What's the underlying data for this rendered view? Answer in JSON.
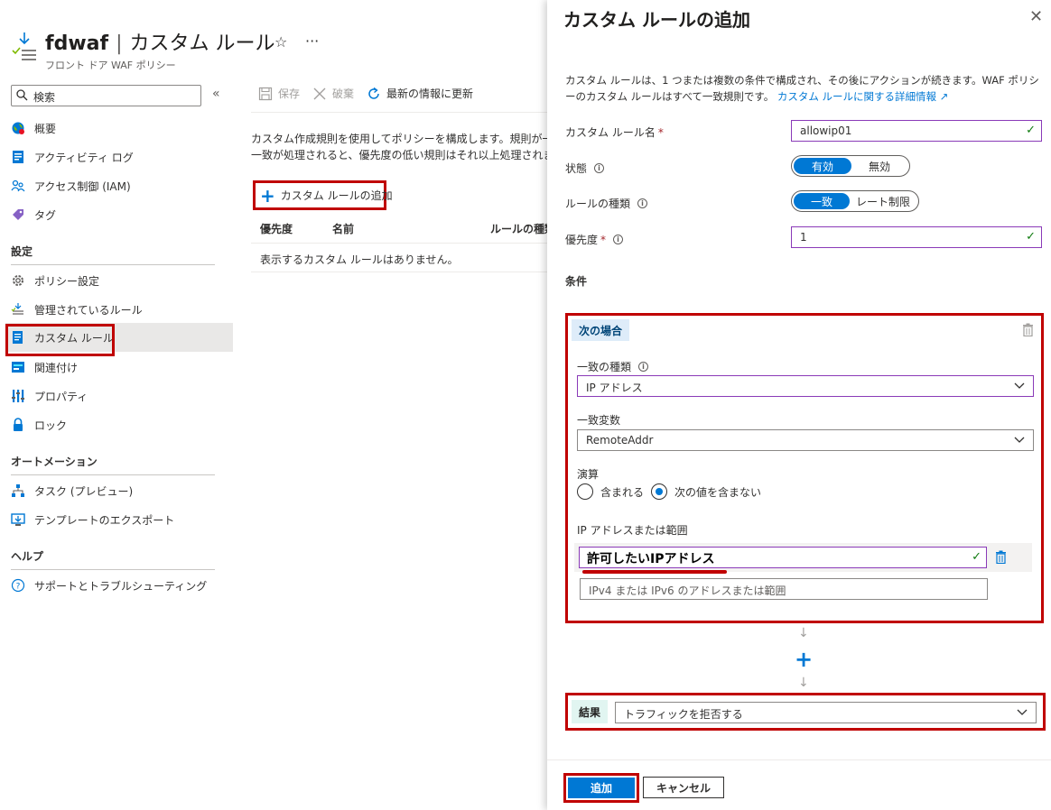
{
  "blade": {
    "title": "fdwaf",
    "title_separator": "|",
    "title_page": "カスタム ルール",
    "subtitle": "フロント ドア WAF ポリシー",
    "favorite_symbol": "☆",
    "more_symbol": "···"
  },
  "search": {
    "placeholder": "検索"
  },
  "nav": {
    "collapse_symbol": "«",
    "items_top": [
      {
        "label": "概要",
        "icon": "globe-icon"
      },
      {
        "label": "アクティビティ ログ",
        "icon": "activity-log-icon"
      },
      {
        "label": "アクセス制御 (IAM)",
        "icon": "people-icon"
      },
      {
        "label": "タグ",
        "icon": "tag-icon"
      }
    ],
    "section_settings": "設定",
    "items_settings": [
      {
        "label": "ポリシー設定",
        "icon": "gear-icon"
      },
      {
        "label": "管理されているルール",
        "icon": "managed-rules-icon"
      },
      {
        "label": "カスタム ルール",
        "icon": "custom-rules-icon"
      },
      {
        "label": "関連付け",
        "icon": "association-icon"
      },
      {
        "label": "プロパティ",
        "icon": "properties-icon"
      },
      {
        "label": "ロック",
        "icon": "lock-icon"
      }
    ],
    "section_automation": "オートメーション",
    "items_automation": [
      {
        "label": "タスク (プレビュー)",
        "icon": "tasks-icon"
      },
      {
        "label": "テンプレートのエクスポート",
        "icon": "export-template-icon"
      }
    ],
    "section_help": "ヘルプ",
    "items_help": [
      {
        "label": "サポートとトラブルシューティング",
        "icon": "help-icon"
      }
    ],
    "active_item": "カスタム ルール"
  },
  "toolbar": {
    "save": "保存",
    "discard": "破棄",
    "refresh": "最新の情報に更新"
  },
  "main": {
    "description_line1": "カスタム作成規則を使用してポリシーを構成します。規則が一致す",
    "description_line2": "一致が処理されると、優先度の低い規則はそれ以上処理されませ",
    "add_rule_button": "カスタム ルールの追加",
    "table": {
      "columns": [
        "優先度",
        "名前",
        "ルールの種類"
      ],
      "empty_message": "表示するカスタム ルールはありません。"
    }
  },
  "panel": {
    "title": "カスタム ルールの追加",
    "close_symbol": "✕",
    "description": "カスタム ルールは、1 つまたは複数の条件で構成され、その後にアクションが続きます。WAF ポリシーのカスタム ルールはすべて一致規則です。",
    "learn_more_link": "カスタム ルールに関する詳細情報",
    "fields": {
      "rule_name_label": "カスタム ルール名",
      "rule_name_value": "allowip01",
      "state_label": "状態",
      "state_options": [
        "有効",
        "無効"
      ],
      "state_selected": "有効",
      "rule_type_label": "ルールの種類",
      "rule_type_options": [
        "一致",
        "レート制限"
      ],
      "rule_type_selected": "一致",
      "priority_label": "優先度",
      "priority_value": "1",
      "required_mark": "*"
    },
    "conditions": {
      "header": "条件",
      "if_label": "次の場合",
      "match_type_label": "一致の種類",
      "match_type_value": "IP アドレス",
      "match_variable_label": "一致変数",
      "match_variable_value": "RemoteAddr",
      "operation_label": "演算",
      "operation_options": [
        "含まれる",
        "次の値を含まない"
      ],
      "operation_selected": "次の値を含まない",
      "ip_label": "IP アドレスまたは範囲",
      "ip_value": "許可したいIPアドレス",
      "ip_placeholder": "IPv4 または IPv6 のアドレスまたは範囲"
    },
    "add_condition_symbol": "+",
    "result": {
      "label": "結果",
      "value": "トラフィックを拒否する"
    },
    "buttons": {
      "add": "追加",
      "cancel": "キャンセル"
    }
  },
  "colors": {
    "accent": "#0078d4",
    "highlight_border": "#c00000",
    "valid_check": "#107c10",
    "focused_border": "#8a3ab8"
  }
}
